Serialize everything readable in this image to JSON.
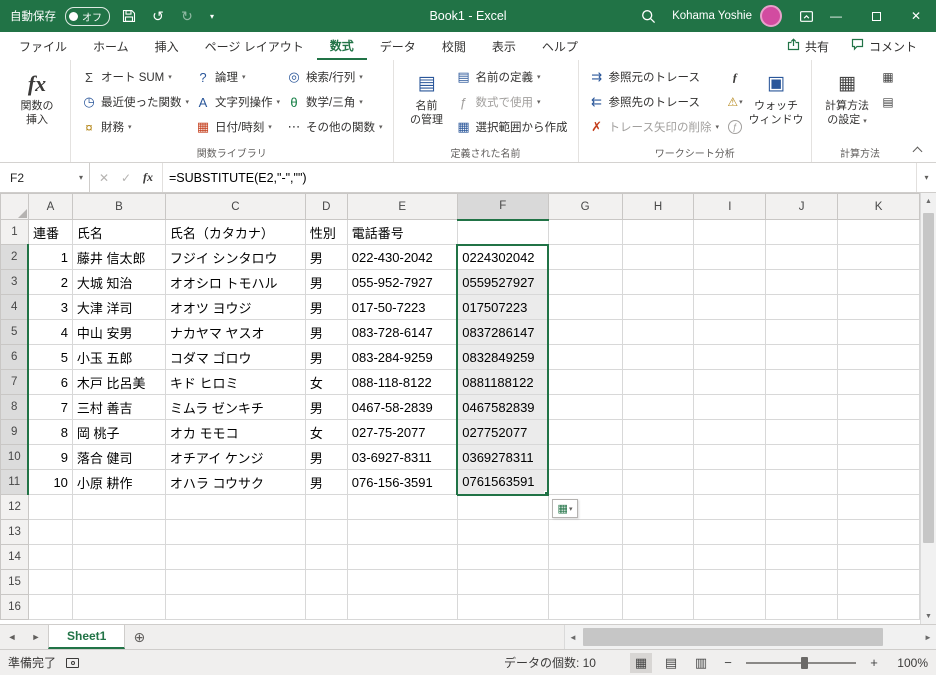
{
  "title_bar": {
    "autosave_label": "自動保存",
    "autosave_state": "オフ",
    "title": "Book1 - Excel",
    "user": "Kohama Yoshie"
  },
  "ribbon": {
    "tabs": [
      "ファイル",
      "ホーム",
      "挿入",
      "ページ レイアウト",
      "数式",
      "データ",
      "校閲",
      "表示",
      "ヘルプ"
    ],
    "active_tab": "数式",
    "share": "共有",
    "comments": "コメント",
    "insert_function": {
      "icon": "fx",
      "l1": "関数の",
      "l2": "挿入"
    },
    "library": {
      "label": "関数ライブラリ",
      "autosum": "オート SUM",
      "recent": "最近使った関数",
      "financial": "財務",
      "logical": "論理",
      "text": "文字列操作",
      "datetime": "日付/時刻",
      "lookup": "検索/行列",
      "math": "数学/三角",
      "more": "その他の関数"
    },
    "defined_names": {
      "label": "定義された名前",
      "manager_l1": "名前",
      "manager_l2": "の管理",
      "define": "名前の定義",
      "use_in_formula": "数式で使用",
      "create_from_selection": "選択範囲から作成"
    },
    "auditing": {
      "label": "ワークシート分析",
      "precedents": "参照元のトレース",
      "dependents": "参照先のトレース",
      "remove_arrows": "トレース矢印の削除",
      "watch_l1": "ウォッチ",
      "watch_l2": "ウィンドウ"
    },
    "calculation": {
      "label": "計算方法",
      "options_l1": "計算方法",
      "options_l2": "の設定"
    }
  },
  "formula_bar": {
    "name_box": "F2",
    "formula": "=SUBSTITUTE(E2,\"-\",\"\")"
  },
  "grid": {
    "columns": [
      "A",
      "B",
      "C",
      "D",
      "E",
      "F",
      "G",
      "H",
      "I",
      "J",
      "K"
    ],
    "selected_column": "F",
    "selection": {
      "range": "F2:F11",
      "active_cell": "F2",
      "first_row": 2,
      "last_row": 11
    },
    "visible_rows": 16,
    "rows": [
      [
        "連番",
        "氏名",
        "氏名（カタカナ）",
        "性別",
        "電話番号",
        ""
      ],
      [
        "1",
        "藤井 信太郎",
        "フジイ シンタロウ",
        "男",
        "022-430-2042",
        "0224302042"
      ],
      [
        "2",
        "大城 知治",
        "オオシロ トモハル",
        "男",
        "055-952-7927",
        "0559527927"
      ],
      [
        "3",
        "大津 洋司",
        "オオツ ヨウジ",
        "男",
        "017-50-7223",
        "017507223"
      ],
      [
        "4",
        "中山 安男",
        "ナカヤマ ヤスオ",
        "男",
        "083-728-6147",
        "0837286147"
      ],
      [
        "5",
        "小玉 五郎",
        "コダマ ゴロウ",
        "男",
        "083-284-9259",
        "0832849259"
      ],
      [
        "6",
        "木戸 比呂美",
        "キド ヒロミ",
        "女",
        "088-118-8122",
        "0881188122"
      ],
      [
        "7",
        "三村 善吉",
        "ミムラ ゼンキチ",
        "男",
        "0467-58-2839",
        "0467582839"
      ],
      [
        "8",
        "岡 桃子",
        "オカ モモコ",
        "女",
        "027-75-2077",
        "027752077"
      ],
      [
        "9",
        "落合 健司",
        "オチアイ ケンジ",
        "男",
        "03-6927-8311",
        "0369278311"
      ],
      [
        "10",
        "小原 耕作",
        "オハラ コウサク",
        "男",
        "076-156-3591",
        "0761563591"
      ]
    ]
  },
  "sheet_bar": {
    "tabs": [
      "Sheet1"
    ],
    "active": "Sheet1"
  },
  "status_bar": {
    "mode": "準備完了",
    "count": "データの個数: 10",
    "zoom": "100%"
  },
  "colors": {
    "accent": "#217346",
    "selection_fill": "#ebebeb"
  }
}
